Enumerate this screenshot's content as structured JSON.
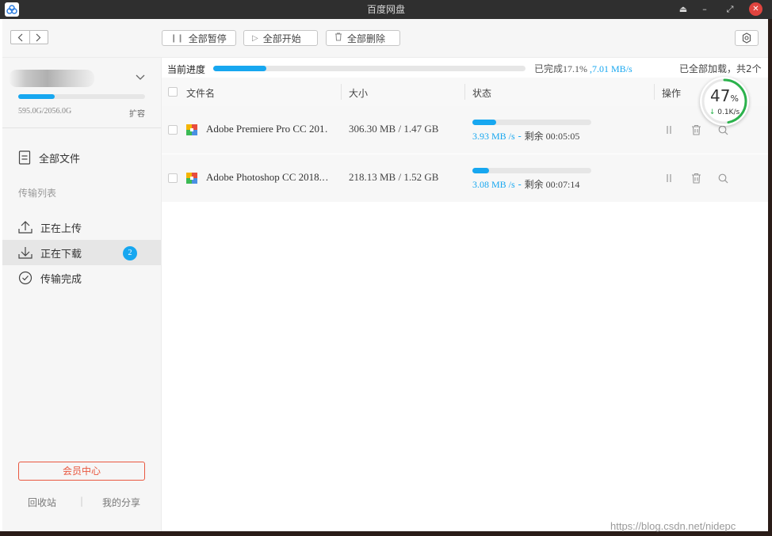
{
  "window": {
    "title": "百度网盘"
  },
  "toolbar": {
    "pause_all": "全部暂停",
    "start_all": "全部开始",
    "delete_all": "全部删除"
  },
  "account": {
    "quota_text": "595.0G/2056.0G",
    "quota_fraction": 0.289,
    "expand_label": "扩容"
  },
  "sidebar": {
    "all_files": "全部文件",
    "transfer_list": "传输列表",
    "uploading": "正在上传",
    "downloading": "正在下载",
    "downloading_count": "2",
    "completed": "传输完成",
    "vip_center": "会员中心",
    "recycle_bin": "回收站",
    "my_share": "我的分享"
  },
  "progress": {
    "label": "当前进度",
    "fraction": 0.171,
    "completed_prefix": "已完成",
    "completed_pct": "17.1%",
    "speed": " ,7.01 MB/s",
    "all_loaded": "已全部加载，共2个"
  },
  "table": {
    "col_name": "文件名",
    "col_size": "大小",
    "col_status": "状态",
    "col_ops": "操作"
  },
  "downloads": [
    {
      "name": "Adobe Premiere Pro CC 201…",
      "size": "306.30 MB / 1.47 GB",
      "fraction": 0.2,
      "speed": "3.93 MB /s",
      "dash": " - ",
      "remaining_label": "剩余",
      "remaining": " 00:05:05"
    },
    {
      "name": "Adobe Photoshop CC 2018.…",
      "size": "218.13 MB / 1.52 GB",
      "fraction": 0.14,
      "speed": "3.08 MB /s",
      "dash": " - ",
      "remaining_label": "剩余",
      "remaining": " 00:07:14"
    }
  ],
  "gauge": {
    "percent": "47",
    "unit": "%",
    "speed": "0.1K/s",
    "fraction": 0.47
  },
  "watermark": "https://blog.csdn.net/nidepc",
  "colors": {
    "accent": "#17a7f0",
    "vip": "#e9573f",
    "gauge_green": "#2bb24c"
  }
}
